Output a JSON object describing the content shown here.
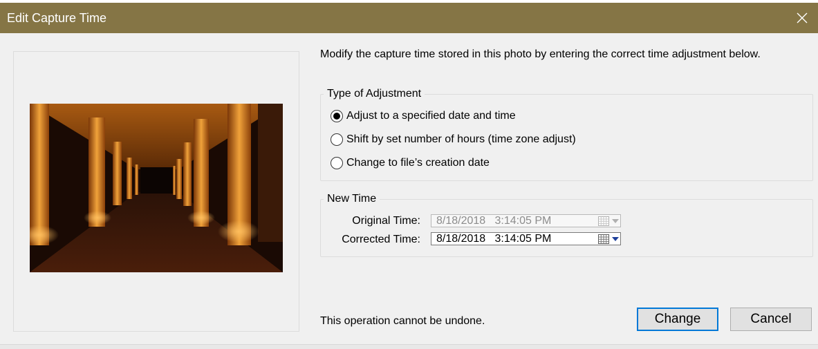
{
  "window": {
    "title": "Edit Capture Time",
    "close_icon": "close-icon"
  },
  "intro_text": "Modify the capture time stored in this photo by entering the correct time adjustment below.",
  "adjustment": {
    "legend": "Type of Adjustment",
    "options": [
      {
        "label": "Adjust to a specified date and time",
        "selected": true
      },
      {
        "label": "Shift by set number of hours (time zone adjust)",
        "selected": false
      },
      {
        "label": "Change to file’s creation date",
        "selected": false
      }
    ]
  },
  "new_time": {
    "legend": "New Time",
    "original_label": "Original Time:",
    "original_value": "8/18/2018   3:14:05 PM",
    "original_enabled": false,
    "corrected_label": "Corrected Time:",
    "corrected_value": "8/18/2018   3:14:05 PM",
    "corrected_enabled": true
  },
  "footer_note": "This operation cannot be undone.",
  "buttons": {
    "change": "Change",
    "cancel": "Cancel"
  },
  "colors": {
    "titlebar": "#857545",
    "default_button_border": "#0078d7",
    "field_arrow": "#1e3f9a"
  }
}
